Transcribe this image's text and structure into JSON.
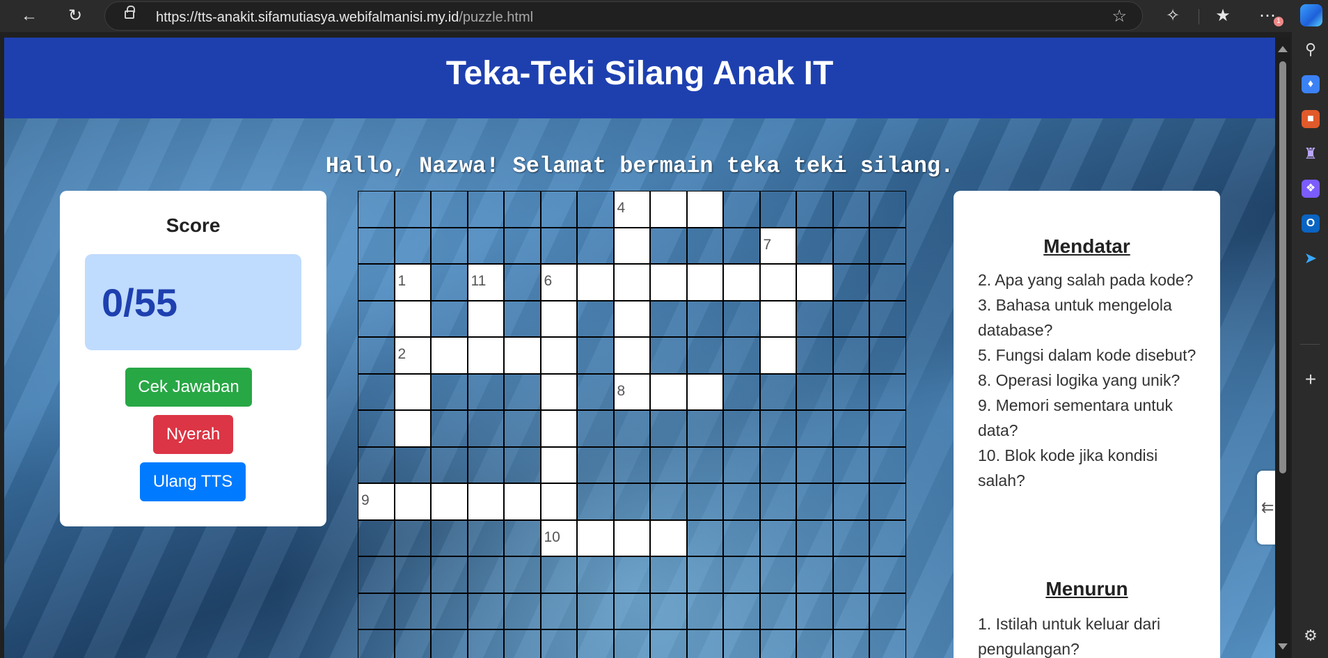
{
  "browser": {
    "url_host": "https://tts-anakit.sifamutiasya.webifalmanisi.my.id",
    "url_path": "/puzzle.html",
    "notification_count": "1"
  },
  "page": {
    "title": "Teka-Teki Silang Anak IT",
    "greeting": "Hallo, Nazwa! Selamat bermain teka teki silang."
  },
  "score": {
    "label": "Score",
    "value": "0/55"
  },
  "buttons": {
    "check": "Cek Jawaban",
    "give_up": "Nyerah",
    "reset": "Ulang TTS"
  },
  "crossword": {
    "cols": 15,
    "rows": 13,
    "white_cells": [
      [
        0,
        7
      ],
      [
        0,
        8
      ],
      [
        0,
        9
      ],
      [
        1,
        7
      ],
      [
        1,
        11
      ],
      [
        2,
        1
      ],
      [
        2,
        3
      ],
      [
        2,
        5
      ],
      [
        2,
        6
      ],
      [
        2,
        7
      ],
      [
        2,
        8
      ],
      [
        2,
        9
      ],
      [
        2,
        10
      ],
      [
        2,
        11
      ],
      [
        2,
        12
      ],
      [
        3,
        1
      ],
      [
        3,
        3
      ],
      [
        3,
        5
      ],
      [
        3,
        7
      ],
      [
        3,
        11
      ],
      [
        4,
        1
      ],
      [
        4,
        2
      ],
      [
        4,
        3
      ],
      [
        4,
        4
      ],
      [
        4,
        5
      ],
      [
        4,
        7
      ],
      [
        4,
        11
      ],
      [
        5,
        1
      ],
      [
        5,
        5
      ],
      [
        5,
        7
      ],
      [
        5,
        8
      ],
      [
        5,
        9
      ],
      [
        6,
        1
      ],
      [
        6,
        5
      ],
      [
        7,
        5
      ],
      [
        8,
        0
      ],
      [
        8,
        1
      ],
      [
        8,
        2
      ],
      [
        8,
        3
      ],
      [
        8,
        4
      ],
      [
        8,
        5
      ],
      [
        9,
        5
      ],
      [
        9,
        6
      ],
      [
        9,
        7
      ],
      [
        9,
        8
      ]
    ],
    "numbers": [
      {
        "r": 0,
        "c": 7,
        "n": "4"
      },
      {
        "r": 1,
        "c": 11,
        "n": "7"
      },
      {
        "r": 2,
        "c": 1,
        "n": "1"
      },
      {
        "r": 2,
        "c": 3,
        "n": "11"
      },
      {
        "r": 2,
        "c": 5,
        "n": "6"
      },
      {
        "r": 4,
        "c": 1,
        "n": "2"
      },
      {
        "r": 5,
        "c": 7,
        "n": "8"
      },
      {
        "r": 8,
        "c": 0,
        "n": "9"
      },
      {
        "r": 9,
        "c": 5,
        "n": "10"
      }
    ]
  },
  "clues": {
    "across_title": "Mendatar",
    "across": [
      "2. Apa yang salah pada kode?",
      "3. Bahasa untuk mengelola database?",
      "5. Fungsi dalam kode disebut?",
      "8. Operasi logika yang unik?",
      "9. Memori sementara untuk data?",
      "10. Blok kode jika kondisi salah?"
    ],
    "down_title": "Menurun",
    "down": [
      "1. Istilah untuk keluar dari pengulangan?"
    ]
  }
}
